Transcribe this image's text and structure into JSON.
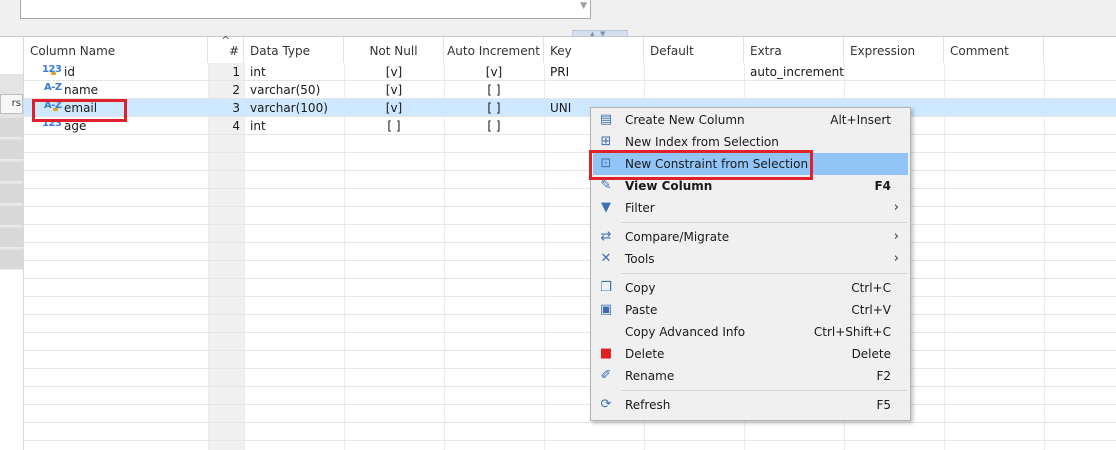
{
  "columns": {
    "name": "Column Name",
    "num": "#",
    "type": "Data Type",
    "notnull": "Not Null",
    "autoinc": "Auto Increment",
    "key": "Key",
    "default": "Default",
    "extra": "Extra",
    "expression": "Expression",
    "comment": "Comment"
  },
  "sort_indicator": "^",
  "side_tab_label": "rs",
  "rows": [
    {
      "icon_text": "123",
      "icon": "numeric-key-icon",
      "name": "id",
      "num": "1",
      "type": "int",
      "notnull": "[v]",
      "autoinc": "[v]",
      "key": "PRI",
      "default": "",
      "extra": "auto_increment"
    },
    {
      "icon_text": "A-Z",
      "icon": "string-type-icon",
      "name": "name",
      "num": "2",
      "type": "varchar(50)",
      "notnull": "[v]",
      "autoinc": "[ ]",
      "key": "",
      "default": "",
      "extra": ""
    },
    {
      "icon_text": "A-Z",
      "icon": "string-key-icon",
      "name": "email",
      "num": "3",
      "type": "varchar(100)",
      "notnull": "[v]",
      "autoinc": "[ ]",
      "key": "UNI",
      "default": "",
      "extra": ""
    },
    {
      "icon_text": "123",
      "icon": "numeric-type-icon",
      "name": "age",
      "num": "4",
      "type": "int",
      "notnull": "[ ]",
      "autoinc": "[ ]",
      "key": "",
      "default": "",
      "extra": ""
    }
  ],
  "menu": {
    "items": [
      {
        "label": "Create New Column",
        "shortcut": "Alt+Insert",
        "icon": "column-icon"
      },
      {
        "label": "New Index from Selection",
        "shortcut": "",
        "icon": "index-icon"
      },
      {
        "label": "New Constraint from Selection",
        "shortcut": "",
        "icon": "constraint-icon"
      },
      {
        "label": "View Column",
        "shortcut": "F4",
        "icon": "pencil-icon"
      },
      {
        "label": "Filter",
        "shortcut": "",
        "icon": "filter-icon"
      },
      {
        "label": "Compare/Migrate",
        "shortcut": "",
        "icon": "compare-icon"
      },
      {
        "label": "Tools",
        "shortcut": "",
        "icon": "tools-icon"
      },
      {
        "label": "Copy",
        "shortcut": "Ctrl+C",
        "icon": "copy-icon"
      },
      {
        "label": "Paste",
        "shortcut": "Ctrl+V",
        "icon": "paste-icon"
      },
      {
        "label": "Copy Advanced Info",
        "shortcut": "Ctrl+Shift+C",
        "icon": ""
      },
      {
        "label": "Delete",
        "shortcut": "Delete",
        "icon": "delete-icon"
      },
      {
        "label": "Rename",
        "shortcut": "F2",
        "icon": "rename-icon"
      },
      {
        "label": "Refresh",
        "shortcut": "F5",
        "icon": "refresh-icon"
      }
    ],
    "submenu_arrow": "›"
  },
  "colors": {
    "selection": "#cde8ff",
    "menu_hover": "#92c5f7",
    "highlight_border": "#e0202a",
    "accent_blue": "#3a7bd5"
  }
}
